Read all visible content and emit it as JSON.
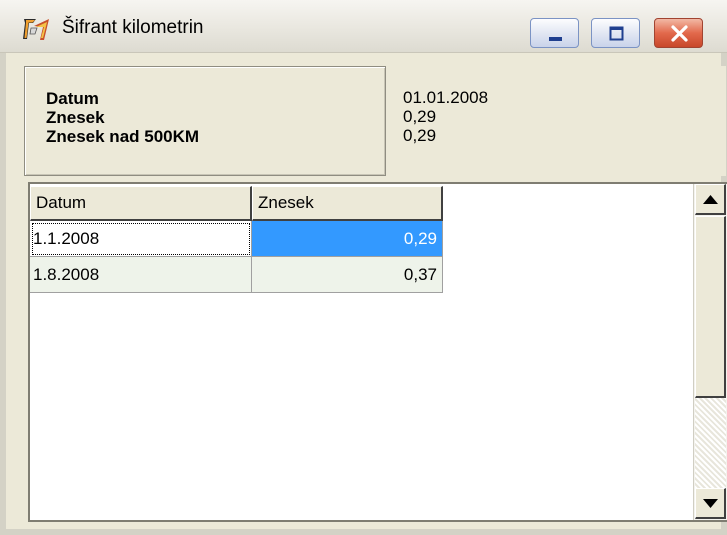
{
  "window": {
    "title": "Šifrant kilometrin",
    "buttons": {
      "minimize": "minimize",
      "maximize": "maximize",
      "close": "close"
    }
  },
  "header": {
    "labels": [
      "Datum",
      "Znesek",
      "Znesek nad 500KM"
    ],
    "values": [
      "01.01.2008",
      "0,29",
      "0,29"
    ]
  },
  "grid": {
    "columns": [
      "Datum",
      "Znesek"
    ],
    "rows": [
      {
        "datum": "1.1.2008",
        "znesek": "0,29"
      },
      {
        "datum": "1.8.2008",
        "znesek": "0,37"
      }
    ],
    "selected_row": 0
  },
  "icons": {
    "app": "app-logo-icon",
    "scroll_up": "arrow-up-icon",
    "scroll_down": "arrow-down-icon"
  },
  "colors": {
    "selection": "#3399ff",
    "window_bg": "#ece9d8",
    "alt_row": "#eef3ea"
  }
}
